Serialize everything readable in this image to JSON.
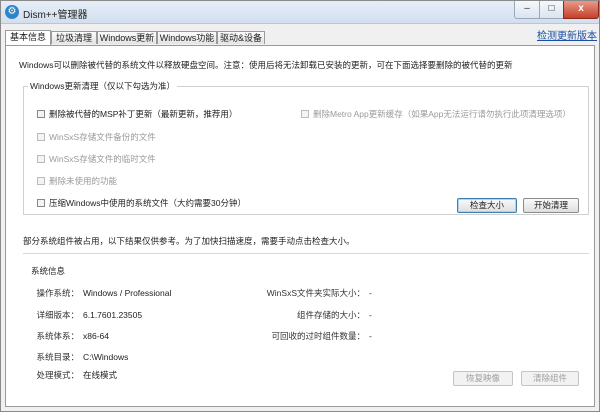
{
  "window": {
    "title": "Dism++管理器",
    "min_glyph": "‒",
    "max_glyph": "□",
    "close_glyph": "x",
    "icon_glyph": "⚙"
  },
  "tabs": [
    {
      "label": "基本信息",
      "active": true
    },
    {
      "label": "垃圾清理",
      "active": false
    },
    {
      "label": "Windows更新",
      "active": false
    },
    {
      "label": "Windows功能",
      "active": false
    },
    {
      "label": "驱动&设备",
      "active": false
    }
  ],
  "top_link": "检测更新版本",
  "intro_text": "Windows可以删除被代替的系统文件以释放硬盘空间。注意：使用后将无法卸载已安装的更新，可在下面选择要删除的被代替的更新",
  "cleanup": {
    "group_title": "Windows更新清理（仅以下勾选为准）",
    "options": [
      {
        "label": "删除被代替的MSP补丁更新（最新更新，推荐用）",
        "disabled": false
      },
      {
        "label": "WinSxS存储文件备份的文件",
        "disabled": true
      },
      {
        "label": "WinSxS存储文件的临时文件",
        "disabled": true
      },
      {
        "label": "删除未使用的功能",
        "disabled": true
      },
      {
        "label": "压缩Windows中使用的系统文件（大约需要30分钟）",
        "disabled": false
      }
    ],
    "metro_option": {
      "label": "删除Metro App更新缓存（如果App无法运行请勿执行此项清理选项）",
      "disabled": true
    },
    "scan_button": "检查大小",
    "clean_button": "开始清理"
  },
  "note_text": "部分系统组件被占用，以下结果仅供参考。为了加快扫描速度，需要手动点击检查大小。",
  "sysinfo": {
    "title": "系统信息",
    "left": [
      {
        "key": "操作系统：",
        "value": "Windows / Professional"
      },
      {
        "key": "详细版本：",
        "value": "6.1.7601.23505"
      },
      {
        "key": "系统体系：",
        "value": "x86-64"
      },
      {
        "key": "系统目录：",
        "value": "C:\\Windows"
      },
      {
        "key": "处理模式：",
        "value": "在线模式"
      }
    ],
    "right": [
      {
        "key": "WinSxS文件夹实际大小：",
        "value": "-"
      },
      {
        "key": "组件存储的大小：",
        "value": "-"
      },
      {
        "key": "可回收的过时组件数量：",
        "value": "-"
      }
    ],
    "btn_left": "恢复映像",
    "btn_right": "清除组件"
  }
}
